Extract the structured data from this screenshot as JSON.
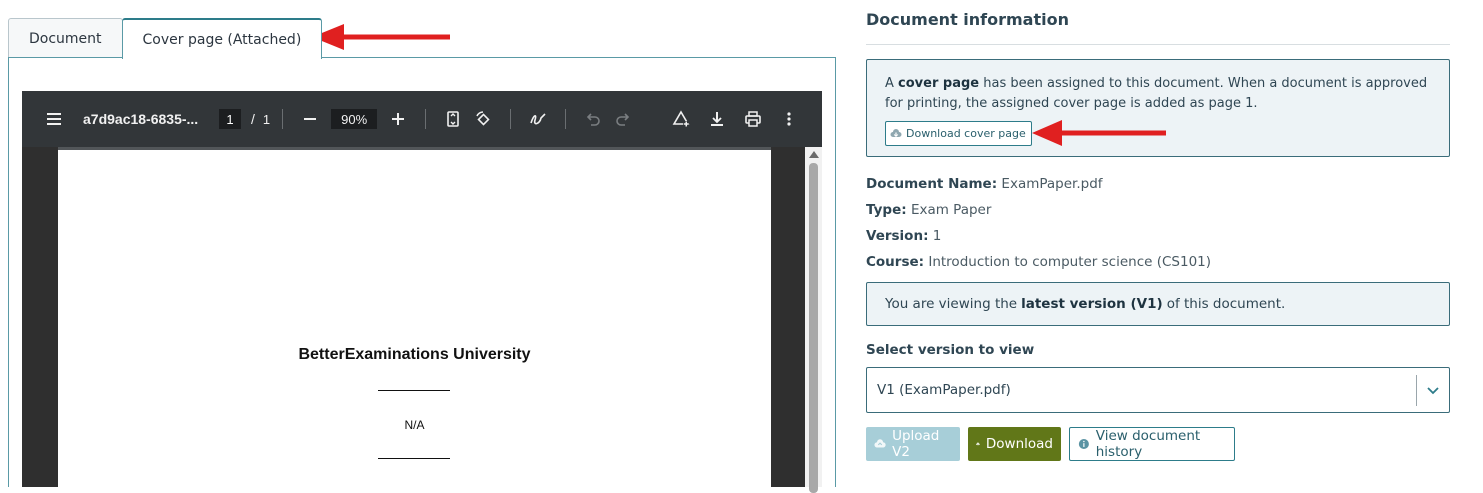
{
  "tabs": [
    {
      "label": "Document",
      "active": false
    },
    {
      "label": "Cover page (Attached)",
      "active": true
    }
  ],
  "viewer": {
    "file_title": "a7d9ac18-6835-...",
    "page_current": "1",
    "page_separator": "/",
    "page_total": "1",
    "zoom": "90%",
    "icons": [
      "menu-icon",
      "zoom-out-icon",
      "zoom-in-icon",
      "fit-page-icon",
      "rotate-icon",
      "draw-icon",
      "undo-icon",
      "redo-icon",
      "annotate-icon",
      "download-icon",
      "print-icon",
      "more-icon"
    ],
    "page": {
      "university": "BetterExaminations University",
      "value": "N/A"
    }
  },
  "info": {
    "title": "Document information",
    "cover_notice": {
      "prefix": "A ",
      "bold": "cover page",
      "suffix": " has been assigned to this document. When a document is approved for printing, the assigned cover page is added as page 1.",
      "download_label": "Download cover page"
    },
    "fields": [
      {
        "label": "Document Name:",
        "value": "ExamPaper.pdf"
      },
      {
        "label": "Type:",
        "value": "Exam Paper"
      },
      {
        "label": "Version:",
        "value": "1"
      },
      {
        "label": "Course:",
        "value": "Introduction to computer science (CS101)"
      }
    ],
    "latest_notice": {
      "prefix": "You are viewing the ",
      "bold": "latest version (V1)",
      "suffix": " of this document."
    },
    "select_label": "Select version to view",
    "select_value": "V1 (ExamPaper.pdf)",
    "buttons": {
      "upload": "Upload V2",
      "download": "Download",
      "history": "View document history"
    }
  },
  "colors": {
    "accent": "#2d7c8a",
    "download_button": "#617718",
    "upload_button_disabled": "#a7ced8",
    "annotation_arrow": "#e02020",
    "pdf_toolbar": "#323639"
  }
}
